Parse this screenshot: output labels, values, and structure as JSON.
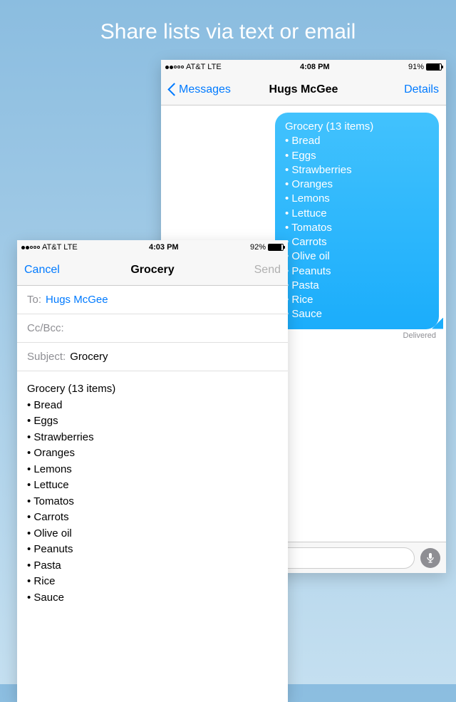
{
  "hero": "Share lists via text or email",
  "messages": {
    "status": {
      "carrier": "AT&T",
      "network": "LTE",
      "time": "4:08 PM",
      "battery_pct": "91%",
      "battery_fill": "91%"
    },
    "nav": {
      "back": "Messages",
      "title": "Hugs McGee",
      "right": "Details"
    },
    "bubble_text": "Grocery (13 items)\n• Bread\n• Eggs\n• Strawberries\n• Oranges\n• Lemons\n• Lettuce\n• Tomatos\n• Carrots\n• Olive oil\n• Peanuts\n• Pasta\n• Rice\n• Sauce",
    "delivered": "Delivered"
  },
  "email": {
    "status": {
      "carrier": "AT&T",
      "network": "LTE",
      "time": "4:03 PM",
      "battery_pct": "92%",
      "battery_fill": "92%"
    },
    "nav": {
      "cancel": "Cancel",
      "title": "Grocery",
      "send": "Send"
    },
    "to_label": "To:",
    "to_value": "Hugs McGee",
    "cc_label": "Cc/Bcc:",
    "subject_label": "Subject:",
    "subject_value": "Grocery",
    "body_text": "Grocery (13 items)\n• Bread\n• Eggs\n• Strawberries\n• Oranges\n• Lemons\n• Lettuce\n• Tomatos\n• Carrots\n• Olive oil\n• Peanuts\n• Pasta\n• Rice\n• Sauce"
  }
}
